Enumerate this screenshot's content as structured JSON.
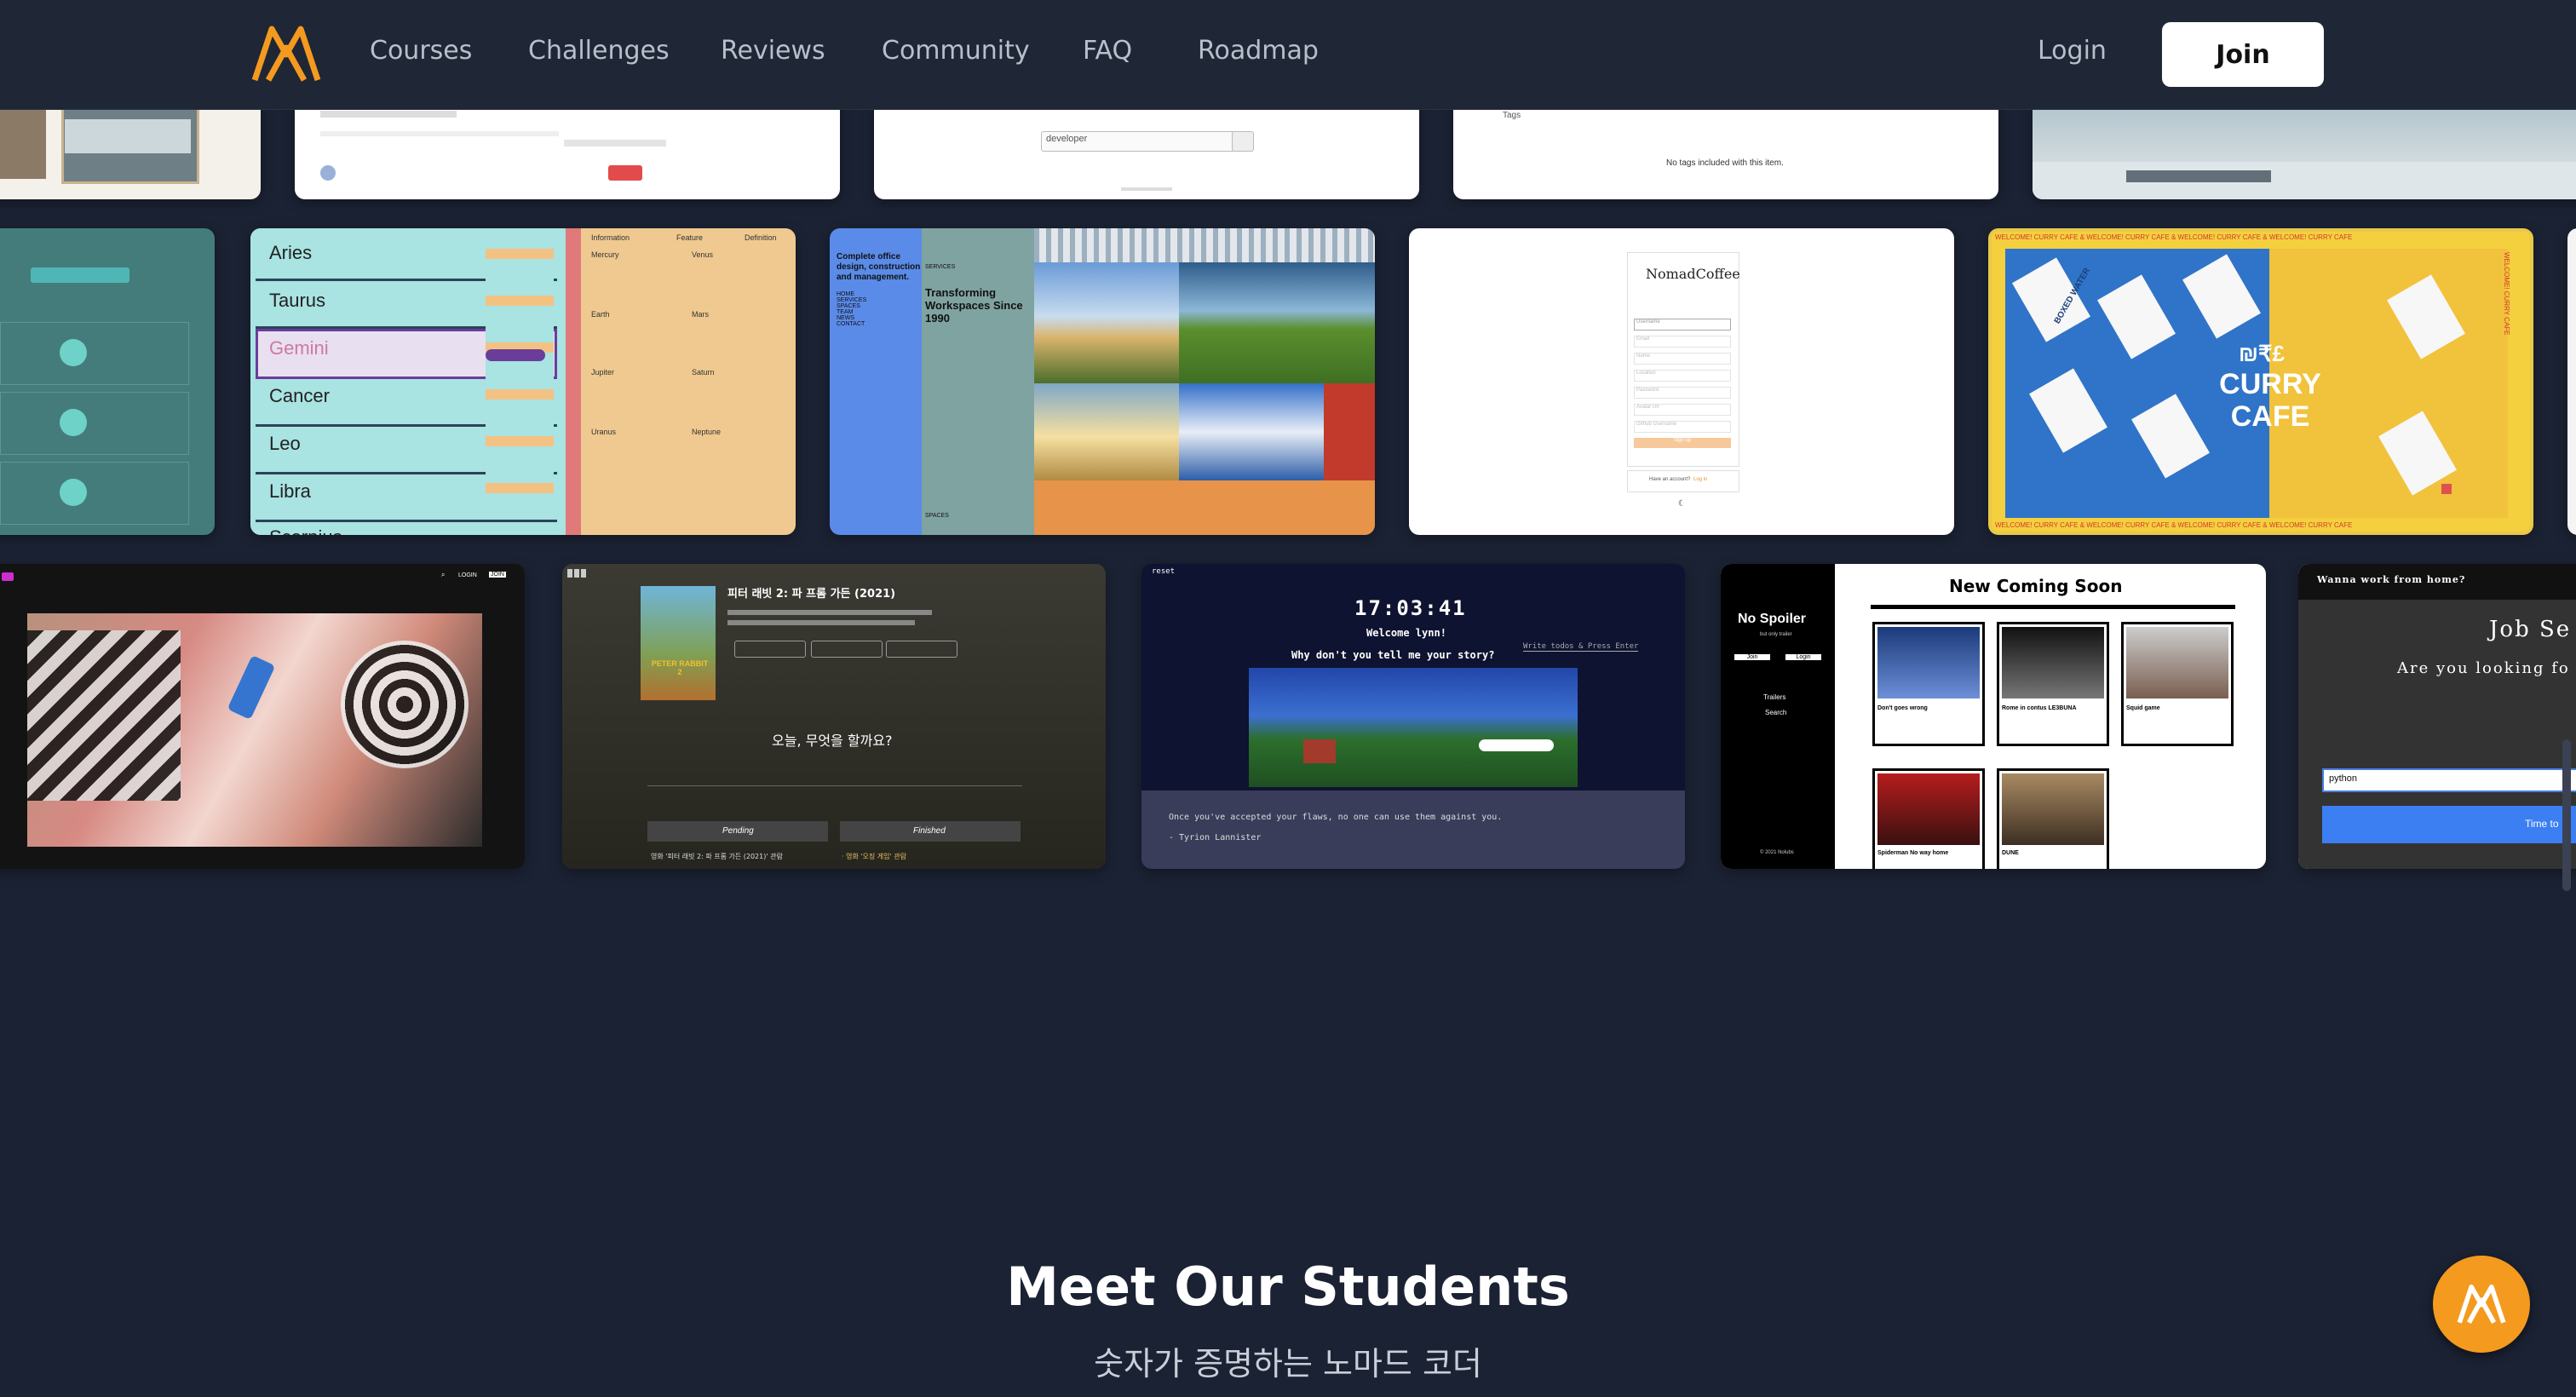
{
  "nav": {
    "links": [
      "Courses",
      "Challenges",
      "Reviews",
      "Community",
      "FAQ",
      "Roadmap"
    ],
    "login": "Login",
    "join": "Join"
  },
  "cards": {
    "row1": {
      "search_value": "developer",
      "tags_label": "Tags",
      "tags_empty": "No tags included with this item."
    },
    "zodiac": {
      "signs": [
        "Aries",
        "Taurus",
        "Gemini",
        "Cancer",
        "Leo",
        "Libra",
        "Scorpius"
      ],
      "tabs": [
        "Information",
        "Feature",
        "Definition"
      ],
      "entries": [
        "Mercury",
        "Venus",
        "Earth",
        "Mars",
        "Jupiter",
        "Saturn",
        "Uranus",
        "Neptune"
      ]
    },
    "workspace": {
      "headline": "Complete office design, construction and management.",
      "title": "Transforming Workspaces Since 1990",
      "menu": [
        "HOME",
        "SERVICES",
        "SPACES",
        "TEAM",
        "NEWS",
        "CONTACT"
      ],
      "section": "SERVICES",
      "spaces_label": "SPACES"
    },
    "nomad": {
      "title": "NomadCoffee",
      "fields": [
        "Username",
        "Email",
        "Name",
        "Location",
        "Password",
        "Avatar Url",
        "Github Username"
      ],
      "signup": "Sign up",
      "login_prompt": "Have an account?",
      "login_link": "Log in"
    },
    "curry": {
      "banner": "WELCOME! CURRY CAFE & WELCOME! CURRY CAFE & WELCOME! CURRY CAFE & WELCOME! CURRY CAFE",
      "logo_top": "₪₹£",
      "logo": "CURRY CAFE",
      "side_text": "WELCOME! CURRY CAFE",
      "box_label": "BOXED WATER"
    },
    "movie": {
      "login": "LOGIN",
      "join": "JOIN"
    },
    "todo": {
      "title": "피터 래빗 2: 파 프롬 가든 (2021)",
      "poster_title": "PETER RABBIT 2",
      "question": "오늘, 무엇을 할까요?",
      "pending": "Pending",
      "finished": "Finished",
      "item": "영화 '피터 래빗 2: 파 프롬 가든 (2021)' 관람"
    },
    "clock": {
      "reset": "reset",
      "time": "17:03:41",
      "welcome": "Welcome lynn!",
      "question": "Why don't you tell me your story?",
      "hint": "Write todos & Press Enter",
      "quote": "Once you've accepted your flaws, no one can use them against you.",
      "author": "- Tyrion Lannister"
    },
    "nospoiler": {
      "brand": "No Spoiler",
      "tagline": "but only trailer",
      "buttons": [
        "Join",
        "Login"
      ],
      "menu": [
        "Trailers",
        "Search"
      ],
      "footer": "© 2021 Nolubs",
      "heading": "New Coming Soon",
      "movies": [
        "Don't goes wrong",
        "Rome in contus LE3BUNA",
        "Squid game",
        "Spiderman No way home",
        "DUNE"
      ]
    },
    "job": {
      "tagline": "Wanna work from home?",
      "title": "Job Se",
      "subtitle": "Are you looking fo",
      "input_value": "python",
      "button": "Time to"
    }
  },
  "section": {
    "title": "Meet Our Students",
    "subtitle": "숫자가 증명하는 노마드 코더"
  },
  "colors": {
    "background": "#1b2233",
    "nav": "#1f2636",
    "brand_orange": "#f49a1f",
    "accent_blue": "#3b7ff2"
  }
}
